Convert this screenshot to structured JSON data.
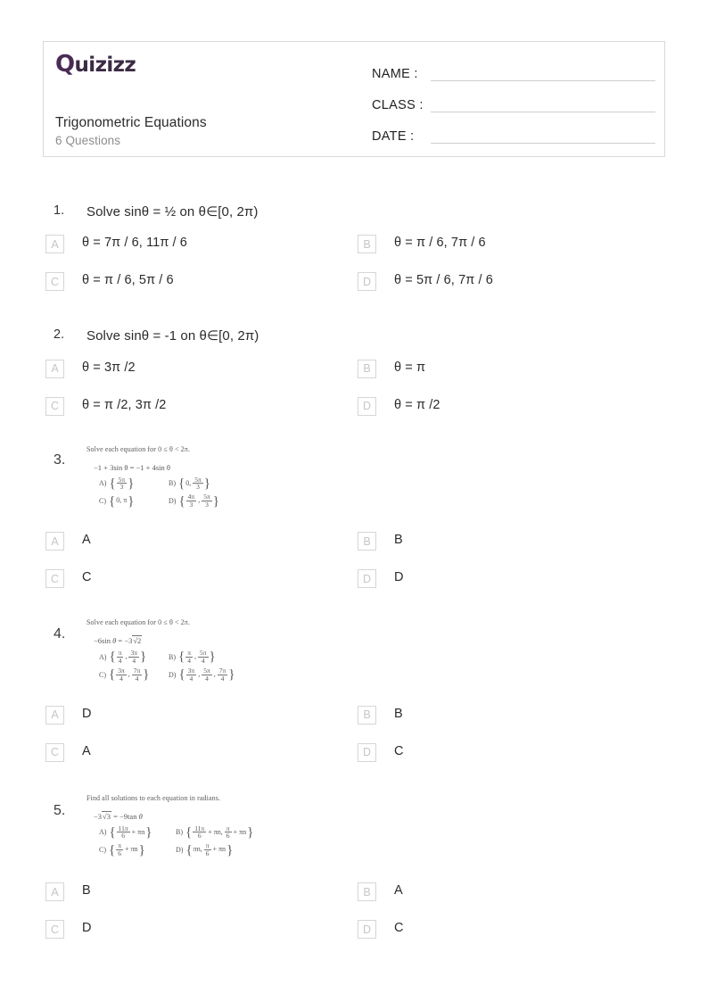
{
  "header": {
    "logo_text": "uizizz",
    "logo_q": "Q",
    "title": "Trigonometric Equations",
    "subtitle": "6 Questions",
    "fields": [
      {
        "label": "NAME :"
      },
      {
        "label": "CLASS :"
      },
      {
        "label": "DATE  :"
      }
    ]
  },
  "colors": {
    "brand_purple": "#4a2b55",
    "title": "#2b2b2b",
    "subtitle": "#8d8d8d",
    "letter_box_border": "#d6d6d6",
    "letter_box_text": "#c6c6c6",
    "card_border": "#d9d9d9"
  },
  "questions": [
    {
      "number": "1.",
      "type": "text",
      "text": "Solve sinθ = ½ on θ∈[0, 2π)",
      "options": [
        {
          "letter": "A",
          "text": "θ = 7π / 6,  11π / 6"
        },
        {
          "letter": "B",
          "text": "θ = π / 6,  7π / 6"
        },
        {
          "letter": "C",
          "text": "θ = π / 6,  5π / 6"
        },
        {
          "letter": "D",
          "text": "θ = 5π / 6,  7π / 6"
        }
      ]
    },
    {
      "number": "2.",
      "type": "text",
      "text": "Solve sinθ = -1 on θ∈[0, 2π)",
      "options": [
        {
          "letter": "A",
          "text": "θ = 3π /2"
        },
        {
          "letter": "B",
          "text": "θ = π"
        },
        {
          "letter": "C",
          "text": "θ = π /2, 3π /2"
        },
        {
          "letter": "D",
          "text": "θ = π /2"
        }
      ]
    },
    {
      "number": "3.",
      "type": "image",
      "image": {
        "prompt": "Solve each equation for 0 ≤ θ < 2π.",
        "equation": "−1 + 3sin θ = −1 + 4sin θ",
        "choices": [
          {
            "tag": "A)",
            "set": "{5π/3}"
          },
          {
            "tag": "B)",
            "set": "{0, 5π/3}"
          },
          {
            "tag": "C)",
            "set": "{0, π}"
          },
          {
            "tag": "D)",
            "set": "{4π/3, 5π/3}"
          }
        ]
      },
      "options": [
        {
          "letter": "A",
          "text": "A"
        },
        {
          "letter": "B",
          "text": "B"
        },
        {
          "letter": "C",
          "text": "C"
        },
        {
          "letter": "D",
          "text": "D"
        }
      ]
    },
    {
      "number": "4.",
      "type": "image",
      "image": {
        "prompt": "Solve each equation for 0 ≤ θ < 2π.",
        "equation": "−6sin θ = −3√2",
        "choices": [
          {
            "tag": "A)",
            "set": "{π/4, 3π/4}"
          },
          {
            "tag": "B)",
            "set": "{π/4, 5π/4}"
          },
          {
            "tag": "C)",
            "set": "{3π/4, 7π/4}"
          },
          {
            "tag": "D)",
            "set": "{3π/4, 5π/4, 7π/4}"
          }
        ]
      },
      "options": [
        {
          "letter": "A",
          "text": "D"
        },
        {
          "letter": "B",
          "text": "B"
        },
        {
          "letter": "C",
          "text": "A"
        },
        {
          "letter": "D",
          "text": "C"
        }
      ]
    },
    {
      "number": "5.",
      "type": "image",
      "image": {
        "prompt": "Find all solutions to each equation in radians.",
        "equation": "−3√3 = −9tan θ",
        "choices": [
          {
            "tag": "A)",
            "set": "{11π/6 + πn}"
          },
          {
            "tag": "B)",
            "set": "{11π/6 + πn, π/6 + πn}"
          },
          {
            "tag": "C)",
            "set": "{π/6 + πn}"
          },
          {
            "tag": "D)",
            "set": "{πn, π/6 + πn}"
          }
        ]
      },
      "options": [
        {
          "letter": "A",
          "text": "B"
        },
        {
          "letter": "B",
          "text": "A"
        },
        {
          "letter": "C",
          "text": "D"
        },
        {
          "letter": "D",
          "text": "C"
        }
      ]
    }
  ]
}
